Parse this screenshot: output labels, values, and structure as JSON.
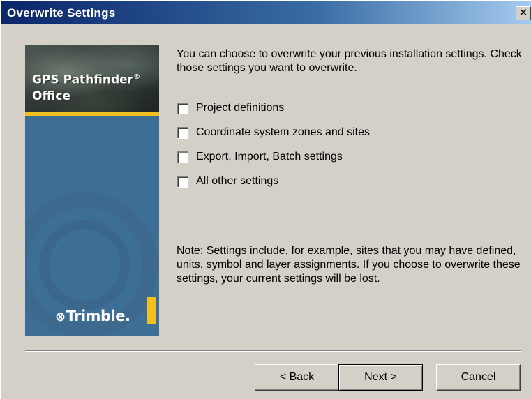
{
  "window": {
    "title": "Overwrite Settings",
    "close_glyph": "✕"
  },
  "banner": {
    "product_line1": "GPS Pathfinder",
    "product_reg": "®",
    "product_line2": "Office",
    "logo_text": "Trimble.",
    "logo_mark": "⊗",
    "accent_color": "#f0c020",
    "background_color": "#3d6f96"
  },
  "intro_text": "You can choose to overwrite your previous installation settings. Check those settings you want to overwrite.",
  "options": [
    {
      "label": "Project definitions",
      "checked": false
    },
    {
      "label": "Coordinate system zones and sites",
      "checked": false
    },
    {
      "label": "Export, Import, Batch settings",
      "checked": false
    },
    {
      "label": "All other settings",
      "checked": false
    }
  ],
  "note_text": "Note: Settings include, for example, sites that you may have defined, units, symbol and layer assignments.  If you choose to overwrite these settings, your current settings will be lost.",
  "buttons": {
    "back": "< Back",
    "next": "Next >",
    "cancel": "Cancel"
  }
}
